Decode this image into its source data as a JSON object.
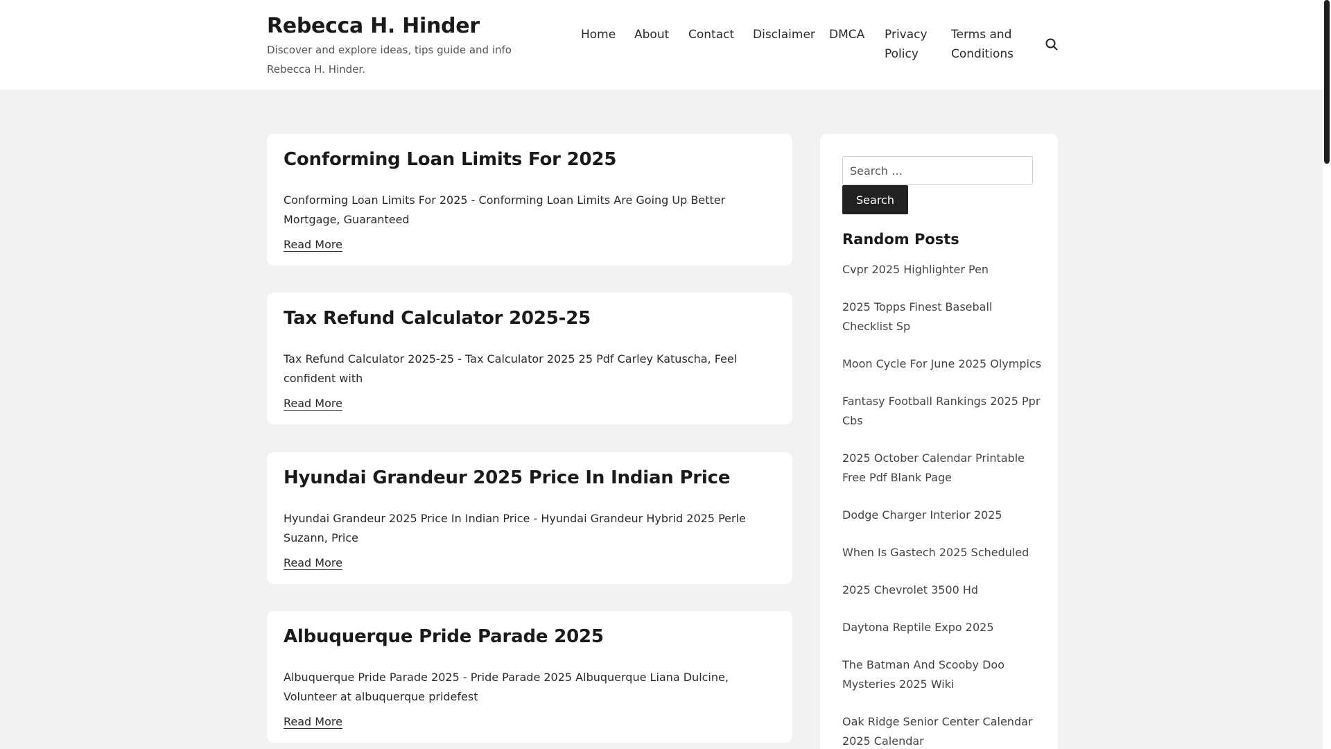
{
  "header": {
    "site_title": "Rebecca H. Hinder",
    "site_description": "Discover and explore ideas, tips guide and info Rebecca H. Hinder.",
    "nav": [
      {
        "label": "Home"
      },
      {
        "label": "About"
      },
      {
        "label": "Contact"
      },
      {
        "label": "Disclaimer"
      },
      {
        "label": "DMCA"
      },
      {
        "label": "Privacy Policy"
      },
      {
        "label": "Terms and Conditions"
      }
    ],
    "search_icon": "search-icon"
  },
  "posts": [
    {
      "title": "Conforming Loan Limits For 2025",
      "excerpt": "Conforming Loan Limits For 2025 - Conforming Loan Limits Are Going Up Better Mortgage, Guaranteed",
      "read_more": "Read More"
    },
    {
      "title": "Tax Refund Calculator 2025-25",
      "excerpt": "Tax Refund Calculator 2025-25 - Tax Calculator 2025 25 Pdf Carley Katuscha, Feel confident with",
      "read_more": "Read More"
    },
    {
      "title": "Hyundai Grandeur 2025 Price In Indian Price",
      "excerpt": "Hyundai Grandeur 2025 Price In Indian Price - Hyundai Grandeur Hybrid 2025 Perle Suzann, Price",
      "read_more": "Read More"
    },
    {
      "title": "Albuquerque Pride Parade 2025",
      "excerpt": "Albuquerque Pride Parade 2025 - Pride Parade 2025 Albuquerque Liana Dulcine, Volunteer at albuquerque pridefest",
      "read_more": "Read More"
    }
  ],
  "sidebar": {
    "search_placeholder": "Search …",
    "search_button": "Search",
    "random_title": "Random Posts",
    "random_posts": [
      "Cvpr 2025 Highlighter Pen",
      "2025 Topps Finest Baseball Checklist Sp",
      "Moon Cycle For June 2025 Olympics",
      "Fantasy Football Rankings 2025 Ppr Cbs",
      "2025 October Calendar Printable Free Pdf Blank Page",
      "Dodge Charger Interior 2025",
      "When Is Gastech 2025 Scheduled",
      "2025 Chevrolet 3500 Hd",
      "Daytona Reptile Expo 2025",
      "The Batman And Scooby Doo Mysteries 2025 Wiki",
      "Oak Ridge Senior Center Calendar 2025 Calendar"
    ]
  }
}
